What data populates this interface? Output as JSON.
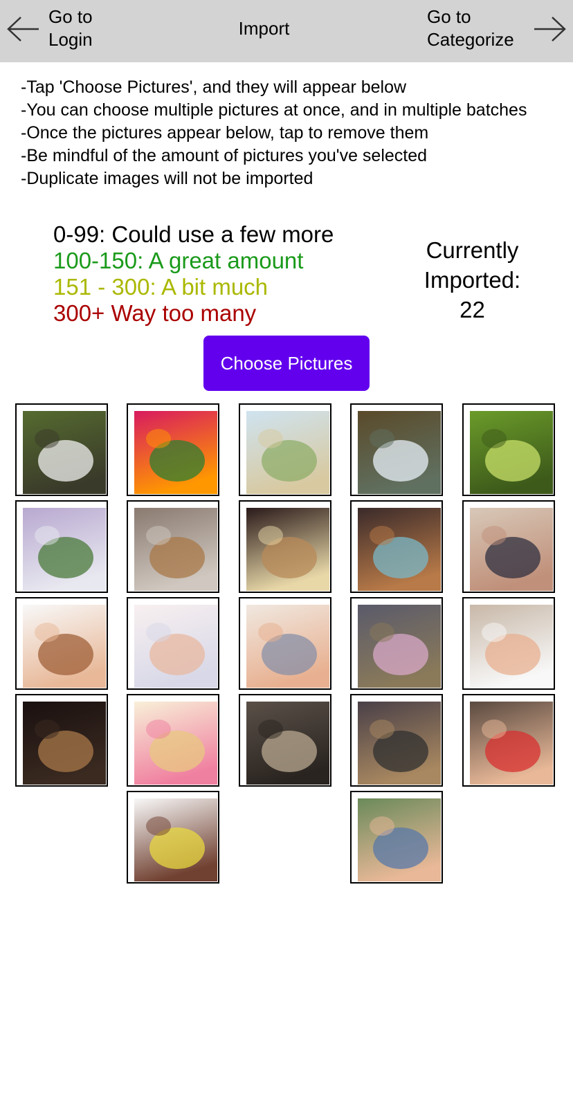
{
  "nav": {
    "back_label": "Go to\nLogin",
    "title": "Import",
    "forward_label": "Go to\nCategorize"
  },
  "instructions": [
    "-Tap 'Choose Pictures', and they will appear below",
    "-You can choose multiple pictures at once, and in multiple batches",
    "-Once the pictures appear below, tap to remove them",
    "-Be mindful of the amount of pictures you've selected",
    "-Duplicate images will not be imported"
  ],
  "legend": [
    {
      "text": "0-99: Could use a few more",
      "color": "#000000"
    },
    {
      "text": "100-150: A great amount",
      "color": "#1a9a1a"
    },
    {
      "text": "151 - 300: A bit much",
      "color": "#aab800"
    },
    {
      "text": "300+ Way too many",
      "color": "#aa0000"
    }
  ],
  "counter": {
    "label": "Currently Imported:",
    "value": "22"
  },
  "choose_button": "Choose Pictures",
  "accent_color": "#6200ee",
  "pictures": [
    {
      "name": "waterfall-photo",
      "colors": [
        "#556b2f",
        "#f0f0f0",
        "#3a3a2a"
      ]
    },
    {
      "name": "pink-flowers-photo",
      "colors": [
        "#d81b60",
        "#2e7d32",
        "#ff9800"
      ]
    },
    {
      "name": "beach-grass-photo",
      "colors": [
        "#cfe3f0",
        "#8fae6a",
        "#d8c9a0"
      ]
    },
    {
      "name": "falls-river-photo",
      "colors": [
        "#5a4a2a",
        "#e8f0f8",
        "#607060"
      ]
    },
    {
      "name": "green-leaves-photo",
      "colors": [
        "#6b9b2a",
        "#c8e06a",
        "#3d5a1a"
      ]
    },
    {
      "name": "misty-waterfall-photo",
      "colors": [
        "#b8a8d0",
        "#4a7a3a",
        "#e8e8f0"
      ]
    },
    {
      "name": "cat-on-blanket-photo",
      "colors": [
        "#8a7a70",
        "#a87848",
        "#d0c8c0"
      ]
    },
    {
      "name": "cat-on-couch-photo",
      "colors": [
        "#2a1a1a",
        "#b88a58",
        "#e8d8a8"
      ]
    },
    {
      "name": "cat-on-pillow-photo",
      "colors": [
        "#3a2a2a",
        "#7ab8c8",
        "#b87a48"
      ]
    },
    {
      "name": "family-portrait-photo",
      "colors": [
        "#d8c8b8",
        "#303040",
        "#c0907a"
      ]
    },
    {
      "name": "smiling-girl-photo",
      "colors": [
        "#f8f8f8",
        "#a0603a",
        "#e8b898"
      ]
    },
    {
      "name": "grandpa-child-photo",
      "colors": [
        "#f8f0f0",
        "#e8b8a0",
        "#d8d8e8"
      ]
    },
    {
      "name": "grandparents-photo",
      "colors": [
        "#f0e8e0",
        "#8890a8",
        "#e8b090"
      ]
    },
    {
      "name": "cat-on-quilt-photo",
      "colors": [
        "#5a5a6a",
        "#d8a8c8",
        "#8a7a5a"
      ]
    },
    {
      "name": "boy-portrait-photo",
      "colors": [
        "#c8b8a8",
        "#e8b090",
        "#f8f8f8"
      ]
    },
    {
      "name": "cat-sitting-photo",
      "colors": [
        "#1a1010",
        "#a8784a",
        "#3a2a20"
      ]
    },
    {
      "name": "blonde-teen-photo",
      "colors": [
        "#f8f0d8",
        "#e8c880",
        "#f080a0"
      ]
    },
    {
      "name": "cat-closeup-photo",
      "colors": [
        "#5a5048",
        "#b8a890",
        "#2a2420"
      ]
    },
    {
      "name": "cat-on-bed-photo",
      "colors": [
        "#4a4048",
        "#303030",
        "#a88860"
      ]
    },
    {
      "name": "family-red-shirts-photo",
      "colors": [
        "#5a4a40",
        "#d83030",
        "#e8b898"
      ]
    },
    {
      "name": "grandparents-kids-photo",
      "colors": [
        "#f8f8f8",
        "#e8d840",
        "#704030"
      ]
    },
    {
      "name": "big-family-photo",
      "colors": [
        "#6a8a5a",
        "#5878a8",
        "#e8b898"
      ]
    }
  ]
}
